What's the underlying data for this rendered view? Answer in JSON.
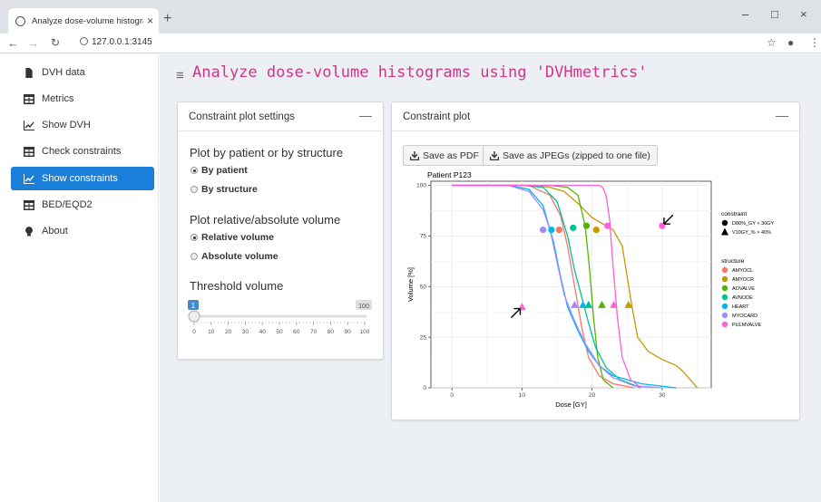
{
  "browser": {
    "tab_title": "Analyze dose-volume histogram",
    "tab_close": "×",
    "new_tab": "+",
    "url": "127.0.0.1:3145",
    "window_controls": [
      "–",
      "□",
      "×"
    ]
  },
  "sidebar": {
    "items": [
      {
        "label": "DVH data",
        "icon": "file-icon"
      },
      {
        "label": "Metrics",
        "icon": "table-icon"
      },
      {
        "label": "Show DVH",
        "icon": "line-chart-icon"
      },
      {
        "label": "Check constraints",
        "icon": "table-icon"
      },
      {
        "label": "Show constraints",
        "icon": "line-chart-icon",
        "active": true
      },
      {
        "label": "BED/EQD2",
        "icon": "table-icon"
      },
      {
        "label": "About",
        "icon": "lightbulb-icon"
      }
    ]
  },
  "header": {
    "title": "Analyze dose-volume histograms using 'DVHmetrics'"
  },
  "settings": {
    "title": "Constraint plot settings",
    "collapse": "—",
    "group1_label": "Plot by patient or by structure",
    "group1_options": [
      "By patient",
      "By structure"
    ],
    "group1_selected": "By patient",
    "group2_label": "Plot relative/absolute volume",
    "group2_options": [
      "Relative volume",
      "Absolute volume"
    ],
    "group2_selected": "Relative volume",
    "threshold_label": "Threshold volume",
    "slider": {
      "value": 1,
      "value_label": "1",
      "min": 0,
      "max": 100,
      "max_label": "100",
      "tick_labels": [
        "0",
        "10",
        "20",
        "30",
        "40",
        "50",
        "60",
        "70",
        "80",
        "90",
        "100"
      ]
    }
  },
  "plot_box": {
    "title": "Constraint plot",
    "collapse": "—",
    "save_pdf": "Save as PDF",
    "save_jpeg": "Save as JPEGs (zipped to one file)"
  },
  "chart_data": {
    "type": "line",
    "title": "Patient P123",
    "xlabel": "Dose [GY]",
    "ylabel": "Volume [%]",
    "xlim": [
      -3,
      37
    ],
    "ylim": [
      0,
      102
    ],
    "x_ticks": [
      "0",
      "10",
      "20",
      "30"
    ],
    "y_ticks": [
      "0",
      "25",
      "50",
      "75",
      "100"
    ],
    "grid": true,
    "legend_placement": "right",
    "series": [
      {
        "name": "AMYOCL",
        "color": "#f8766d",
        "points": [
          [
            0,
            100
          ],
          [
            11,
            100
          ],
          [
            14,
            95
          ],
          [
            15.5,
            85
          ],
          [
            16.5,
            70
          ],
          [
            17.5,
            50
          ],
          [
            18.5,
            30
          ],
          [
            19.5,
            15
          ],
          [
            21,
            6
          ],
          [
            23,
            2
          ],
          [
            26,
            0
          ]
        ]
      },
      {
        "name": "AMYOCR",
        "color": "#c49a00",
        "points": [
          [
            0,
            100
          ],
          [
            12,
            100
          ],
          [
            14,
            99
          ],
          [
            16,
            97
          ],
          [
            18,
            91
          ],
          [
            20,
            84
          ],
          [
            21.5,
            81
          ],
          [
            23,
            78
          ],
          [
            24.3,
            70
          ],
          [
            25,
            55
          ],
          [
            25.7,
            40
          ],
          [
            26.5,
            25
          ],
          [
            28,
            18
          ],
          [
            30,
            14
          ],
          [
            32,
            11
          ],
          [
            33,
            8
          ],
          [
            35,
            0
          ]
        ]
      },
      {
        "name": "AOVALVE",
        "color": "#53b400",
        "points": [
          [
            0,
            100
          ],
          [
            14,
            100
          ],
          [
            16.5,
            99
          ],
          [
            18,
            95
          ],
          [
            19,
            80
          ],
          [
            19.6,
            60
          ],
          [
            20.2,
            35
          ],
          [
            20.8,
            15
          ],
          [
            21.6,
            4
          ],
          [
            23,
            0
          ]
        ]
      },
      {
        "name": "AVNODE",
        "color": "#00c094",
        "points": [
          [
            0,
            100
          ],
          [
            10,
            100
          ],
          [
            13,
            99
          ],
          [
            15,
            92
          ],
          [
            16.5,
            75
          ],
          [
            17.5,
            58
          ],
          [
            18.5,
            45
          ],
          [
            19.5,
            32
          ],
          [
            20.5,
            20
          ],
          [
            22,
            10
          ],
          [
            24,
            4
          ],
          [
            27,
            0
          ]
        ]
      },
      {
        "name": "HEART",
        "color": "#00b6eb",
        "points": [
          [
            0,
            100
          ],
          [
            8,
            100
          ],
          [
            11,
            98
          ],
          [
            13,
            90
          ],
          [
            14.5,
            72
          ],
          [
            15.5,
            55
          ],
          [
            16.5,
            40
          ],
          [
            18,
            28
          ],
          [
            19.5,
            18
          ],
          [
            21,
            11
          ],
          [
            23,
            6
          ],
          [
            27,
            2
          ],
          [
            32,
            0
          ]
        ]
      },
      {
        "name": "MYOCARD",
        "color": "#a58aff",
        "points": [
          [
            0,
            100
          ],
          [
            8,
            100
          ],
          [
            11,
            97
          ],
          [
            13,
            88
          ],
          [
            14,
            78
          ],
          [
            15,
            62
          ],
          [
            16,
            46
          ],
          [
            17.5,
            33
          ],
          [
            19,
            22
          ],
          [
            21,
            11
          ],
          [
            23,
            5
          ],
          [
            26,
            1
          ],
          [
            30,
            0
          ]
        ]
      },
      {
        "name": "PULMVALVE",
        "color": "#fb61d7",
        "points": [
          [
            0,
            100
          ],
          [
            21,
            100
          ],
          [
            21.5,
            99
          ],
          [
            22,
            95
          ],
          [
            22.5,
            83
          ],
          [
            23,
            60
          ],
          [
            23.6,
            35
          ],
          [
            24.3,
            15
          ],
          [
            25.5,
            4
          ],
          [
            27,
            0
          ]
        ]
      }
    ],
    "constraint_legend": {
      "title": "constraint",
      "items": [
        {
          "label": "D80%_GY < 30GY",
          "shape": "circle"
        },
        {
          "label": "V10GY_% > 40%",
          "shape": "triangle"
        }
      ]
    },
    "structure_legend_title": "structure",
    "markers": [
      {
        "shape": "circle",
        "series": "MYOCARD",
        "x": 13,
        "y": 78
      },
      {
        "shape": "circle",
        "series": "HEART",
        "x": 14.2,
        "y": 78
      },
      {
        "shape": "circle",
        "series": "AMYOCL",
        "x": 15.3,
        "y": 78
      },
      {
        "shape": "circle",
        "series": "AVNODE",
        "x": 17.3,
        "y": 79
      },
      {
        "shape": "circle",
        "series": "AOVALVE",
        "x": 19.2,
        "y": 80
      },
      {
        "shape": "circle",
        "series": "AMYOCR",
        "x": 20.6,
        "y": 78
      },
      {
        "shape": "circle",
        "series": "PULMVALVE",
        "x": 22.2,
        "y": 80
      },
      {
        "shape": "circle",
        "series": "PULMVALVE",
        "x": 30,
        "y": 80
      },
      {
        "shape": "triangle",
        "series": "PULMVALVE",
        "x": 10,
        "y": 40
      },
      {
        "shape": "triangle",
        "series": "MYOCARD",
        "x": 17.5,
        "y": 41
      },
      {
        "shape": "triangle",
        "series": "HEART",
        "x": 18.7,
        "y": 41
      },
      {
        "shape": "triangle",
        "series": "AVNODE",
        "x": 19.5,
        "y": 41
      },
      {
        "shape": "triangle",
        "series": "AOVALVE",
        "x": 21.4,
        "y": 41
      },
      {
        "shape": "triangle",
        "series": "PULMVALVE",
        "x": 23.1,
        "y": 41
      },
      {
        "shape": "triangle",
        "series": "AMYOCR",
        "x": 25.2,
        "y": 41
      }
    ],
    "arrows": [
      {
        "direction": "down-left",
        "x": 30,
        "y": 80
      },
      {
        "direction": "up-left",
        "x": 10,
        "y": 40
      }
    ]
  }
}
